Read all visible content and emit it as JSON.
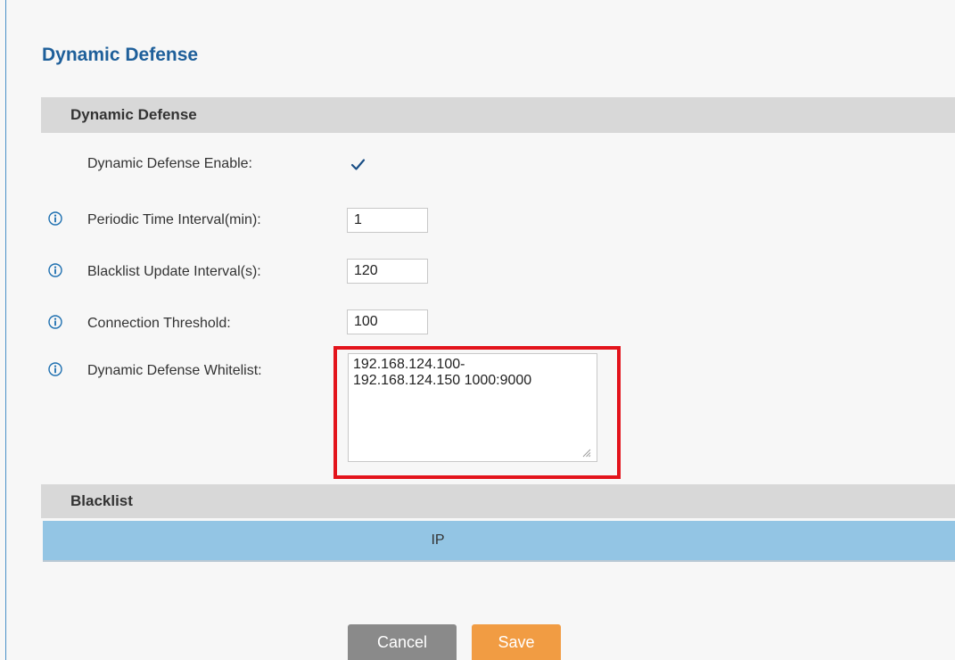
{
  "page": {
    "title": "Dynamic Defense"
  },
  "section_dynamic_defense": {
    "header": "Dynamic Defense",
    "fields": {
      "enable": {
        "label": "Dynamic Defense Enable:",
        "checked": true
      },
      "periodic_interval": {
        "label": "Periodic Time Interval(min):",
        "value": "1"
      },
      "blacklist_interval": {
        "label": "Blacklist Update Interval(s):",
        "value": "120"
      },
      "connection_threshold": {
        "label": "Connection Threshold:",
        "value": "100"
      },
      "whitelist": {
        "label": "Dynamic Defense Whitelist:",
        "value": "192.168.124.100-\n192.168.124.150 1000:9000"
      }
    }
  },
  "section_blacklist": {
    "header": "Blacklist",
    "columns": [
      "IP"
    ]
  },
  "buttons": {
    "cancel": "Cancel",
    "save": "Save"
  },
  "colors": {
    "title": "#1e5f9a",
    "section_header_bg": "#d8d8d8",
    "table_header_bg": "#93c5e4",
    "highlight": "#e3141c",
    "cancel_bg": "#8a8a8a",
    "save_bg": "#f19c43",
    "info_icon": "#1d6fb0"
  },
  "icons": {
    "info": "info-circle-icon",
    "check": "checkmark-icon",
    "resize": "resize-grip-icon"
  }
}
